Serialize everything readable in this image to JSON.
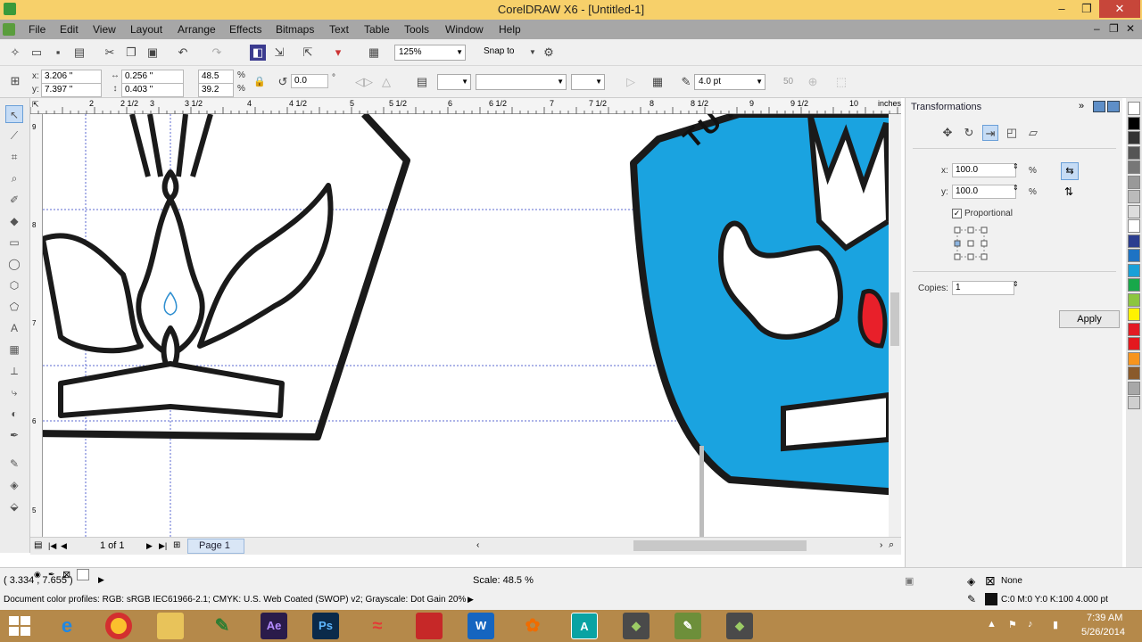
{
  "window": {
    "title": "CorelDRAW X6 - [Untitled-1]",
    "min_glyph": "–",
    "max_glyph": "❐",
    "close_glyph": "✕"
  },
  "menu": [
    "File",
    "Edit",
    "View",
    "Layout",
    "Arrange",
    "Effects",
    "Bitmaps",
    "Text",
    "Table",
    "Tools",
    "Window",
    "Help"
  ],
  "menu_right": {
    "min": "–",
    "max": "❐",
    "close": "✕"
  },
  "standard_toolbar": {
    "zoom": "125%",
    "snap_to": "Snap to"
  },
  "property_bar": {
    "x_label": "x:",
    "x": "3.206 \"",
    "y_label": "y:",
    "y": "7.397 \"",
    "w": "0.256 \"",
    "h": "0.403 \"",
    "scale_w": "48.5",
    "scale_h": "39.2",
    "pct": "%",
    "angle": "0.0",
    "deg": "°",
    "outline_width": "4.0 pt",
    "miter": "50"
  },
  "rulers": {
    "unit": "inches",
    "h_ticks": [
      "2",
      "2 1/2",
      "3",
      "3 1/2",
      "4",
      "4 1/2",
      "5",
      "5 1/2",
      "6",
      "6 1/2",
      "7",
      "7 1/2",
      "8",
      "8 1/2",
      "9",
      "9 1/2",
      "10"
    ],
    "v_ticks": [
      "9",
      "8",
      "7",
      "6",
      "5"
    ]
  },
  "canvas_text": {
    "tut": "TUT"
  },
  "page_nav": {
    "page_count": "1 of 1",
    "page_tab": "Page 1"
  },
  "docker": {
    "title": "Transformations",
    "x_label": "x:",
    "x_value": "100.0",
    "y_label": "y:",
    "y_value": "100.0",
    "pct": "%",
    "proportional_label": "Proportional",
    "proportional_checked": "✓",
    "copies_label": "Copies:",
    "copies_value": "1",
    "apply_label": "Apply"
  },
  "palette_colors": [
    "#ffffff",
    "#000000",
    "#333333",
    "#555555",
    "#777777",
    "#999999",
    "#bbbbbb",
    "#dddddd",
    "#ffffff",
    "#2b3d8f",
    "#1e73c4",
    "#19a0d8",
    "#18a84a",
    "#8cc63f",
    "#fff200",
    "#e31c24",
    "#e4181e",
    "#f7941d",
    "#8a5a2b",
    "#a8a8a8",
    "#cfcfcf"
  ],
  "status": {
    "coords": "( 3.334 , 7.655 )",
    "scale": "Scale: 48.5 %",
    "profiles": "Document color profiles: RGB: sRGB IEC61966-2.1; CMYK: U.S. Web Coated (SWOP) v2; Grayscale: Dot Gain 20%",
    "fill": "None",
    "outline": "C:0 M:0 Y:0 K:100  4.000 pt"
  },
  "taskbar": {
    "time": "7:39 AM",
    "date": "5/26/2014",
    "apps": [
      "Ae",
      "Ps",
      "A"
    ]
  },
  "colors": {
    "title_bar": "#f7d06a",
    "menu_bar": "#a7a7a7",
    "taskbar": "#b5894a",
    "logo_blue": "#1aa3e0",
    "logo_red": "#e8202a",
    "guide": "#5b6ad0"
  }
}
